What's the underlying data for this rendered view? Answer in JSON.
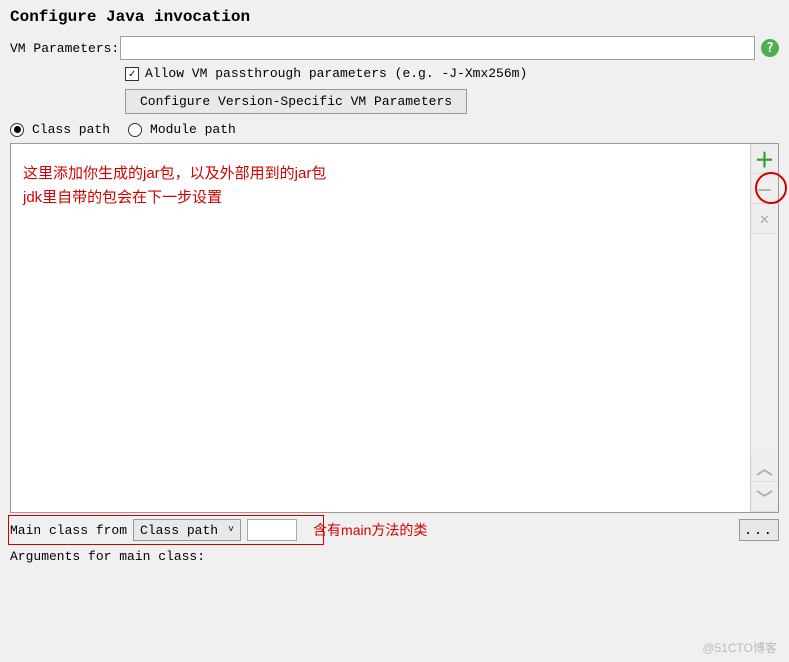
{
  "heading": "Configure Java invocation",
  "vm": {
    "label": "VM Parameters:",
    "value": "",
    "help_tooltip": "?"
  },
  "allow_passthrough": {
    "checked": true,
    "label": "Allow VM passthrough parameters (e.g. -J-Xmx256m)"
  },
  "configure_button": "Configure Version-Specific VM Parameters",
  "path_mode": {
    "options": [
      "Class path",
      "Module path"
    ],
    "selected": 0
  },
  "side_buttons": {
    "add": "＋",
    "remove": "－",
    "delete": "✕",
    "up": "︿",
    "down": "﹀"
  },
  "annotations": {
    "list_line1": "这里添加你生成的jar包，以及外部用到的jar包",
    "list_line2": "jdk里自带的包会在下一步设置",
    "main_class": "含有main方法的类"
  },
  "main_class": {
    "label": "Main class from",
    "dropdown_value": "Class path",
    "value": "",
    "browse": "..."
  },
  "arguments_label": "Arguments for main class:",
  "watermark": "@51CTO博客"
}
